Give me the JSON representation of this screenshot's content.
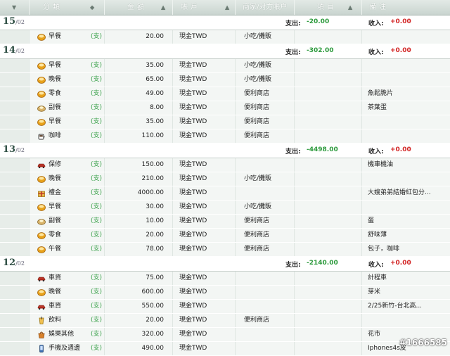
{
  "header": {
    "columns": [
      {
        "label": "分類",
        "arrow": "◆"
      },
      {
        "label": "金額",
        "arrow": "▲"
      },
      {
        "label": "賬戶",
        "arrow": "▲"
      },
      {
        "label": "商家/对方賬户",
        "arrow": ""
      },
      {
        "label": "項目",
        "arrow": "▲"
      },
      {
        "label": "備注",
        "arrow": ""
      }
    ]
  },
  "labels": {
    "expense": "支出:",
    "income": "收入:"
  },
  "days": [
    {
      "day": "15",
      "month": "/02",
      "expense": "-20.00",
      "income": "+0.00",
      "rows": [
        {
          "icon": "bowl-icon",
          "category": "早餐",
          "type": "(支)",
          "amount": "20.00",
          "account": "現金TWD",
          "merchant": "小吃/攤販",
          "note": ""
        }
      ]
    },
    {
      "day": "14",
      "month": "/02",
      "expense": "-302.00",
      "income": "+0.00",
      "rows": [
        {
          "icon": "bowl-icon",
          "category": "早餐",
          "type": "(支)",
          "amount": "35.00",
          "account": "現金TWD",
          "merchant": "小吃/攤販",
          "note": ""
        },
        {
          "icon": "bowl-icon",
          "category": "晚餐",
          "type": "(支)",
          "amount": "65.00",
          "account": "現金TWD",
          "merchant": "小吃/攤販",
          "note": ""
        },
        {
          "icon": "bowl-icon",
          "category": "零食",
          "type": "(支)",
          "amount": "49.00",
          "account": "現金TWD",
          "merchant": "便利商店",
          "note": "魚鬆脆片"
        },
        {
          "icon": "egg-icon",
          "category": "副餐",
          "type": "(支)",
          "amount": "8.00",
          "account": "現金TWD",
          "merchant": "便利商店",
          "note": "茶葉蛋"
        },
        {
          "icon": "bowl-icon",
          "category": "早餐",
          "type": "(支)",
          "amount": "35.00",
          "account": "現金TWD",
          "merchant": "便利商店",
          "note": ""
        },
        {
          "icon": "coffee-icon",
          "category": "咖啡",
          "type": "(支)",
          "amount": "110.00",
          "account": "現金TWD",
          "merchant": "便利商店",
          "note": ""
        }
      ]
    },
    {
      "day": "13",
      "month": "/02",
      "expense": "-4498.00",
      "income": "+0.00",
      "rows": [
        {
          "icon": "car-icon",
          "category": "保修",
          "type": "(支)",
          "amount": "150.00",
          "account": "現金TWD",
          "merchant": "",
          "note": "機車機油"
        },
        {
          "icon": "bowl-icon",
          "category": "晚餐",
          "type": "(支)",
          "amount": "210.00",
          "account": "現金TWD",
          "merchant": "小吃/攤販",
          "note": ""
        },
        {
          "icon": "gift-icon",
          "category": "禮金",
          "type": "(支)",
          "amount": "4000.00",
          "account": "現金TWD",
          "merchant": "",
          "note": "大嫂弟弟結婚紅包分..."
        },
        {
          "icon": "bowl-icon",
          "category": "早餐",
          "type": "(支)",
          "amount": "30.00",
          "account": "現金TWD",
          "merchant": "小吃/攤販",
          "note": ""
        },
        {
          "icon": "egg-icon",
          "category": "副餐",
          "type": "(支)",
          "amount": "10.00",
          "account": "現金TWD",
          "merchant": "便利商店",
          "note": "蛋"
        },
        {
          "icon": "bowl-icon",
          "category": "零食",
          "type": "(支)",
          "amount": "20.00",
          "account": "現金TWD",
          "merchant": "便利商店",
          "note": "舒味薄"
        },
        {
          "icon": "bowl-icon",
          "category": "午餐",
          "type": "(支)",
          "amount": "78.00",
          "account": "現金TWD",
          "merchant": "便利商店",
          "note": "包子，咖啡"
        }
      ]
    },
    {
      "day": "12",
      "month": "/02",
      "expense": "-2140.00",
      "income": "+0.00",
      "rows": [
        {
          "icon": "car-icon",
          "category": "車資",
          "type": "(支)",
          "amount": "75.00",
          "account": "現金TWD",
          "merchant": "",
          "note": "計程車"
        },
        {
          "icon": "bowl-icon",
          "category": "晚餐",
          "type": "(支)",
          "amount": "600.00",
          "account": "現金TWD",
          "merchant": "",
          "note": "芽米"
        },
        {
          "icon": "car-icon",
          "category": "車資",
          "type": "(支)",
          "amount": "550.00",
          "account": "現金TWD",
          "merchant": "",
          "note": "2/25新竹-台北高..."
        },
        {
          "icon": "cup-icon",
          "category": "飲料",
          "type": "(支)",
          "amount": "20.00",
          "account": "現金TWD",
          "merchant": "便利商店",
          "note": ""
        },
        {
          "icon": "bag-icon",
          "category": "娛樂其他",
          "type": "(支)",
          "amount": "320.00",
          "account": "現金TWD",
          "merchant": "",
          "note": "花市"
        },
        {
          "icon": "phone-icon",
          "category": "手機及週邊",
          "type": "(支)",
          "amount": "490.00",
          "account": "現金TWD",
          "merchant": "",
          "note": "Iphones4s皮"
        }
      ]
    }
  ],
  "watermark": "#1666585",
  "colors": {
    "expense": "#2c9a3c",
    "income": "#d22222",
    "header": "#c9d4cf",
    "row": "#f3f6f4"
  }
}
